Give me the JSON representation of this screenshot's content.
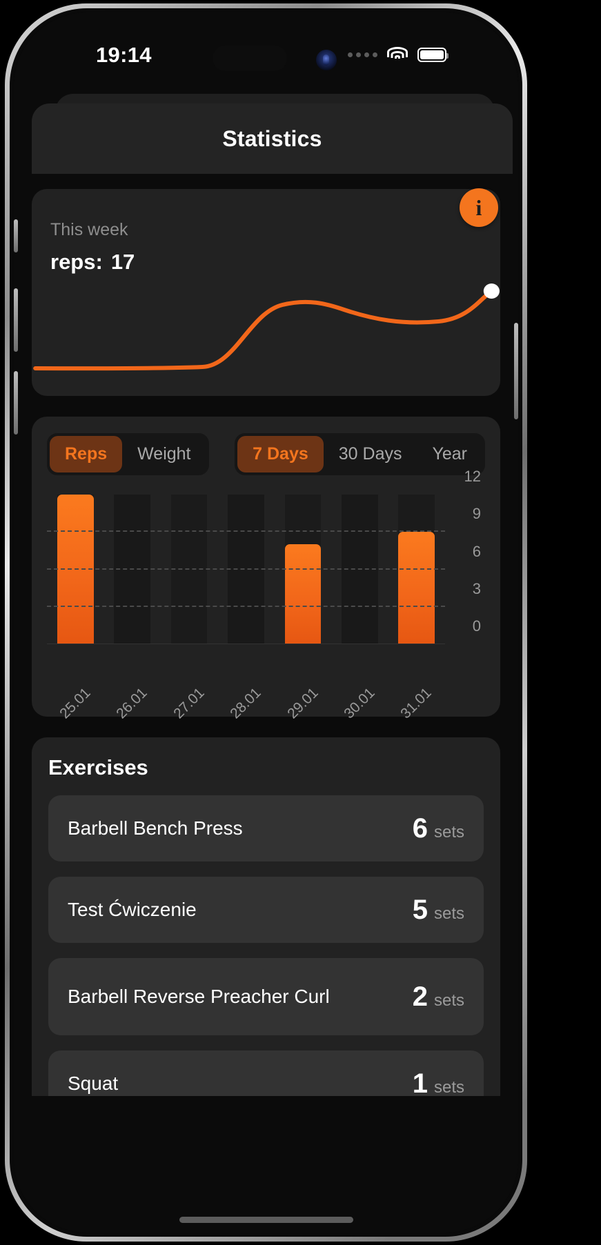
{
  "statusbar": {
    "time": "19:14",
    "signal_icon": "signal-dots-icon",
    "wifi_icon": "wifi-icon",
    "battery_icon": "battery-icon",
    "camera_icon": "front-camera-icon"
  },
  "navbar": {
    "title": "Statistics"
  },
  "week_card": {
    "label": "This week",
    "metric_label": "reps:",
    "metric_value": "17",
    "info_button_label": "i",
    "accent": "#F4751E"
  },
  "metric_segment": {
    "options": [
      "Reps",
      "Weight"
    ],
    "selected": "Reps"
  },
  "range_segment": {
    "options": [
      "7 Days",
      "30 Days",
      "Year"
    ],
    "selected": "7 Days"
  },
  "exercises": {
    "title": "Exercises",
    "unit_label": "sets",
    "items": [
      {
        "name": "Barbell Bench Press",
        "sets": "6"
      },
      {
        "name": "Test Ćwiczenie",
        "sets": "5"
      },
      {
        "name": "Barbell Reverse Preacher Curl",
        "sets": "2"
      },
      {
        "name": "Squat",
        "sets": "1"
      }
    ]
  },
  "chart_data": [
    {
      "type": "bar",
      "title": "Reps per day (7 Days)",
      "categories": [
        "25.01",
        "26.01",
        "27.01",
        "28.01",
        "29.01",
        "30.01",
        "31.01"
      ],
      "values": [
        12,
        0,
        0,
        0,
        8,
        0,
        9
      ],
      "ylabel": "",
      "xlabel": "",
      "ylim": [
        0,
        12
      ],
      "yticks": [
        0,
        3,
        6,
        9,
        12
      ],
      "grid": true,
      "legend": false,
      "bar_color": "#F2671A"
    },
    {
      "type": "line",
      "title": "This week reps trend",
      "x": [
        0,
        1,
        2,
        3,
        4,
        5,
        6,
        7,
        8,
        9
      ],
      "values": [
        1,
        1,
        1,
        1.1,
        4.5,
        6.4,
        6.2,
        5.6,
        5.6,
        7.6
      ],
      "ylim": [
        0,
        9
      ],
      "grid": false,
      "legend": false,
      "line_color": "#F2671A",
      "endpoint_marker_color": "#FFFFFF"
    }
  ]
}
